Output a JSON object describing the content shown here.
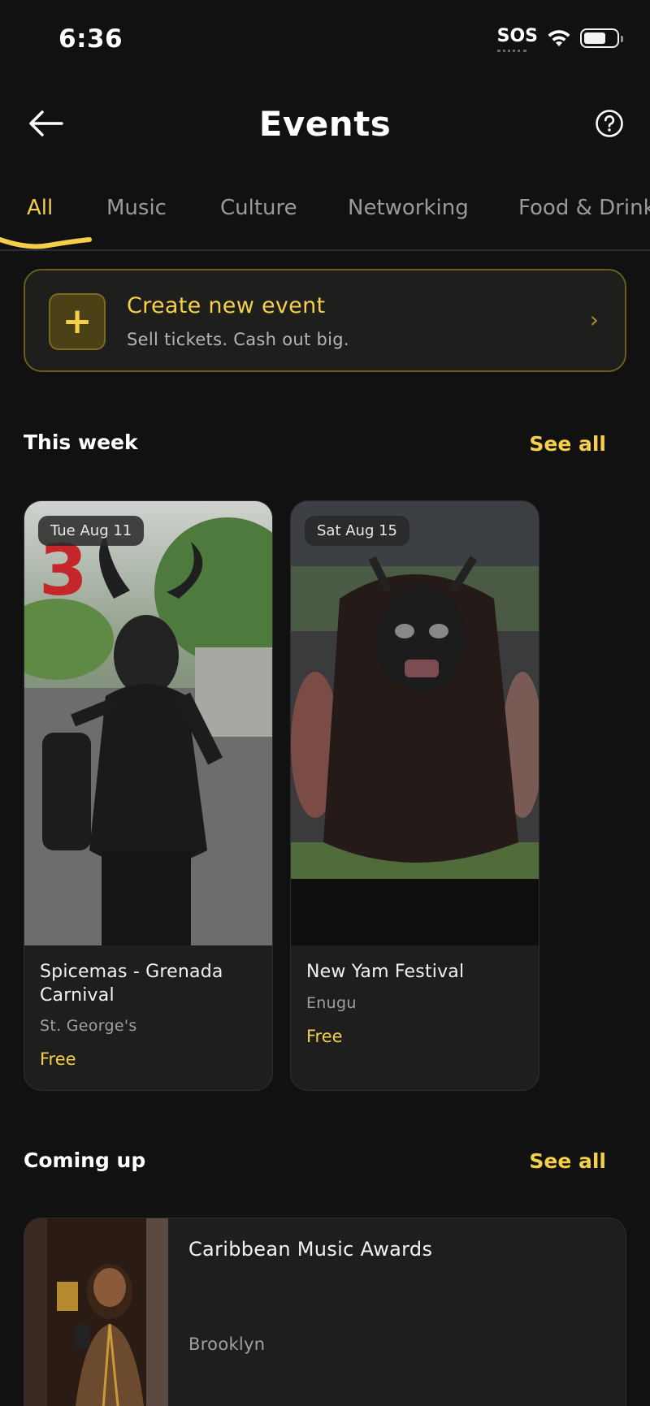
{
  "status_bar": {
    "time": "6:36",
    "carrier": "SOS",
    "icons": [
      "wifi-icon",
      "battery-icon"
    ],
    "battery_level": 0.58
  },
  "header": {
    "title": "Events",
    "back_icon": "arrow-left-icon",
    "help_icon": "question-circle-icon"
  },
  "tabs": [
    {
      "label": "All",
      "active": true
    },
    {
      "label": "Music",
      "active": false
    },
    {
      "label": "Culture",
      "active": false
    },
    {
      "label": "Networking",
      "active": false
    },
    {
      "label": "Food & Drink",
      "active": false
    }
  ],
  "create_event": {
    "icon": "plus-icon",
    "title": "Create new event",
    "subtitle": "Sell tickets. Cash out big.",
    "chevron": "›"
  },
  "this_week": {
    "title": "This week",
    "see_all": "See all",
    "events": [
      {
        "date": "Tue Aug 11",
        "name": "Spicemas - Grenada Carnival",
        "location": "St. George's",
        "price": "Free"
      },
      {
        "date": "Sat Aug 15",
        "name": "New Yam Festival",
        "location": "Enugu",
        "price": "Free"
      }
    ]
  },
  "coming_up": {
    "title": "Coming up",
    "see_all": "See all",
    "events": [
      {
        "name": "Caribbean Music Awards",
        "location": "Brooklyn"
      }
    ]
  },
  "colors": {
    "background": "#111111",
    "accent": "#f5cf4a",
    "card": "#1e1e1e",
    "muted_text": "#a0a0a0"
  }
}
